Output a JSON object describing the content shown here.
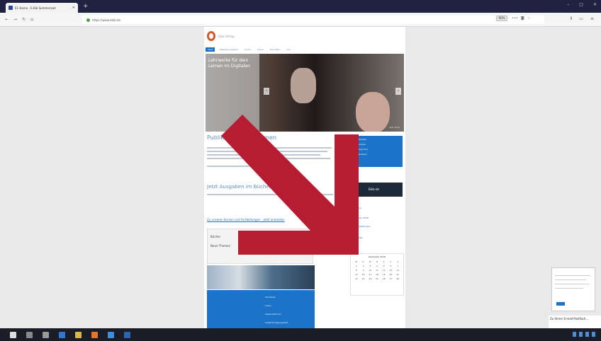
{
  "browser": {
    "tab_title": "E1 Home - E-Bib Sommerzeit",
    "new_tab": "+",
    "url": "https://www.ebib.de",
    "zoom": "90%",
    "window_controls": [
      "–",
      "□",
      "✕"
    ]
  },
  "site": {
    "logo_text": "Ebib Verlag",
    "nav": [
      "Start",
      "Digitales Angebot",
      "Archiv",
      "Kurse",
      "Das Team",
      "Info"
    ],
    "hero": {
      "title": "Lehrwerke für dein Lernen im Digitalen",
      "caption": "ebib 2018"
    },
    "headline": "Publikationen & Themen",
    "headline2": "Jetzt Ausgaben im Bücherregal",
    "link_heading": "Zu unseren Kursen und Fortbildungen - jetzt anmelden",
    "box_rows": [
      "Bücher",
      "Neue Themen"
    ],
    "blue_items": [
      "Schreiben",
      "Lesen",
      "Präsentationen",
      "Ausbildungsangebote"
    ]
  },
  "sidebar": {
    "blue_lines": [
      "Newsletter",
      "Anmelden",
      "Kurstermine",
      "Mitarbeiten"
    ],
    "banner": "Ebib.de",
    "links": [
      "Termine",
      "Kalender 2018",
      "Veranstaltungen",
      "Aktuelles"
    ],
    "calendar_title": "Dezember 2018",
    "calendar_days": [
      "M",
      "D",
      "M",
      "D",
      "F",
      "S",
      "S",
      "1",
      "2",
      "3",
      "4",
      "5",
      "6",
      "7",
      "8",
      "9",
      "10",
      "11",
      "12",
      "13",
      "14",
      "15",
      "16",
      "17",
      "18",
      "19",
      "20",
      "21",
      "22",
      "23",
      "24",
      "25",
      "26",
      "27",
      "28"
    ]
  },
  "notification": {
    "text": "Zu Ihrem E-mail-Postfach..."
  },
  "colors": {
    "arrow": "#b71c33",
    "accent": "#1d73c8",
    "tabbar": "#202340"
  }
}
